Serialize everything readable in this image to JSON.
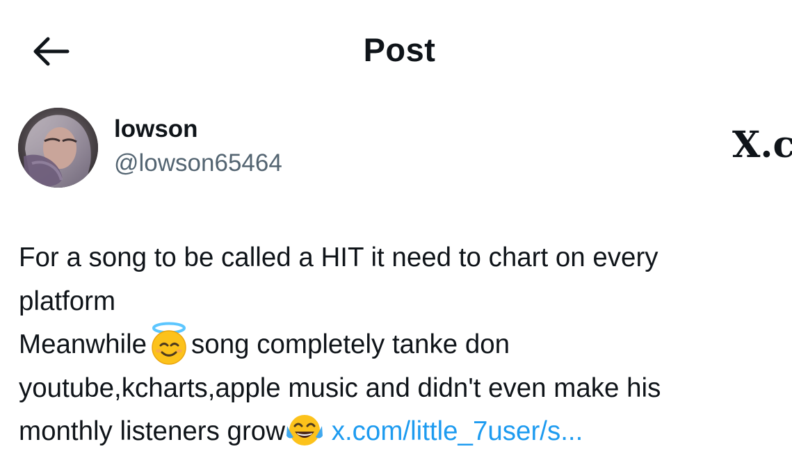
{
  "header": {
    "title": "Post",
    "back_icon": "arrow-left-icon"
  },
  "author": {
    "name": "lowson",
    "handle": "@lowson65464",
    "avatar_icon": "user-avatar"
  },
  "source_mark": "X.c",
  "post": {
    "line1": "For a song to be called a HIT it need to chart on every",
    "line2": "platform",
    "line3_a": "Meanwhile",
    "line3_emoji": "smiling-face-with-halo-emoji",
    "line3_b": "song completely tanke don",
    "line4": "youtube,kcharts,apple music and didn't even make his",
    "line5_a": "monthly listeners grow",
    "line5_emoji": "face-with-tears-of-joy-emoji",
    "link_text": "x.com/little_7user/s..."
  },
  "colors": {
    "text": "#0f1419",
    "secondary": "#536471",
    "link": "#1d9bf0",
    "background": "#ffffff"
  }
}
